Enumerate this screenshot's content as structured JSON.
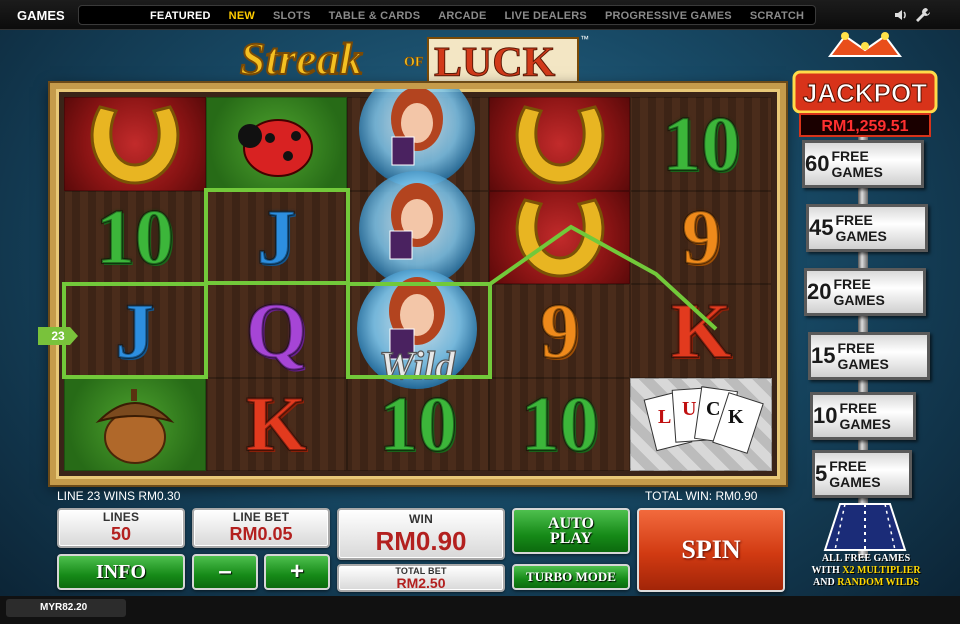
{
  "nav": {
    "games_label": "GAMES",
    "links": [
      {
        "label": "FEATURED",
        "state": "active"
      },
      {
        "label": "NEW",
        "state": "highlight"
      },
      {
        "label": "SLOTS",
        "state": ""
      },
      {
        "label": "TABLE & CARDS",
        "state": ""
      },
      {
        "label": "ARCADE",
        "state": ""
      },
      {
        "label": "LIVE DEALERS",
        "state": ""
      },
      {
        "label": "PROGRESSIVE GAMES",
        "state": ""
      },
      {
        "label": "SCRATCH",
        "state": ""
      }
    ]
  },
  "logo": {
    "word1": "Streak",
    "word2": "OF",
    "word3": "LUCK",
    "tm": "™"
  },
  "reels": {
    "rows": [
      [
        "horseshoe",
        "ladybug",
        "wild",
        "horseshoe",
        "10"
      ],
      [
        "10",
        "J",
        "wild",
        "horseshoe",
        "9"
      ],
      [
        "J",
        "Q",
        "wild",
        "9",
        "K"
      ],
      [
        "acorn",
        "K",
        "10",
        "10",
        "luck-cards"
      ]
    ],
    "wild_label": "Wild",
    "luck_label": "LUCK"
  },
  "payline_badge": "23",
  "status": {
    "line_win": "LINE 23 WINS RM0.30",
    "total_win": "TOTAL WIN: RM0.90"
  },
  "jackpot": {
    "title": "JACKPOT",
    "amount": "RM1,259.51",
    "free_games": [
      {
        "num": "60",
        "label": "FREE GAMES"
      },
      {
        "num": "45",
        "label": "FREE GAMES"
      },
      {
        "num": "20",
        "label": "FREE GAMES"
      },
      {
        "num": "15",
        "label": "FREE GAMES"
      },
      {
        "num": "10",
        "label": "FREE GAMES"
      },
      {
        "num": "5",
        "label": "FREE GAMES"
      }
    ],
    "note_line1": "ALL FREE GAMES",
    "note_line2a": "WITH ",
    "note_line2b": "X2 MULTIPLIER",
    "note_line3a": "AND ",
    "note_line3b": "RANDOM WILDS"
  },
  "controls": {
    "lines_label": "LINES",
    "lines_value": "50",
    "linebet_label": "LINE BET",
    "linebet_value": "RM0.05",
    "win_label": "WIN",
    "win_value": "RM0.90",
    "autoplay_label_1": "AUTO",
    "autoplay_label_2": "PLAY",
    "spin_label": "SPIN",
    "info_label": "INFO",
    "minus_label": "–",
    "plus_label": "+",
    "totalbet_label": "TOTAL BET",
    "totalbet_value": "RM2.50",
    "turbo_label": "TURBO MODE"
  },
  "balance": {
    "value": "MYR82.20"
  }
}
